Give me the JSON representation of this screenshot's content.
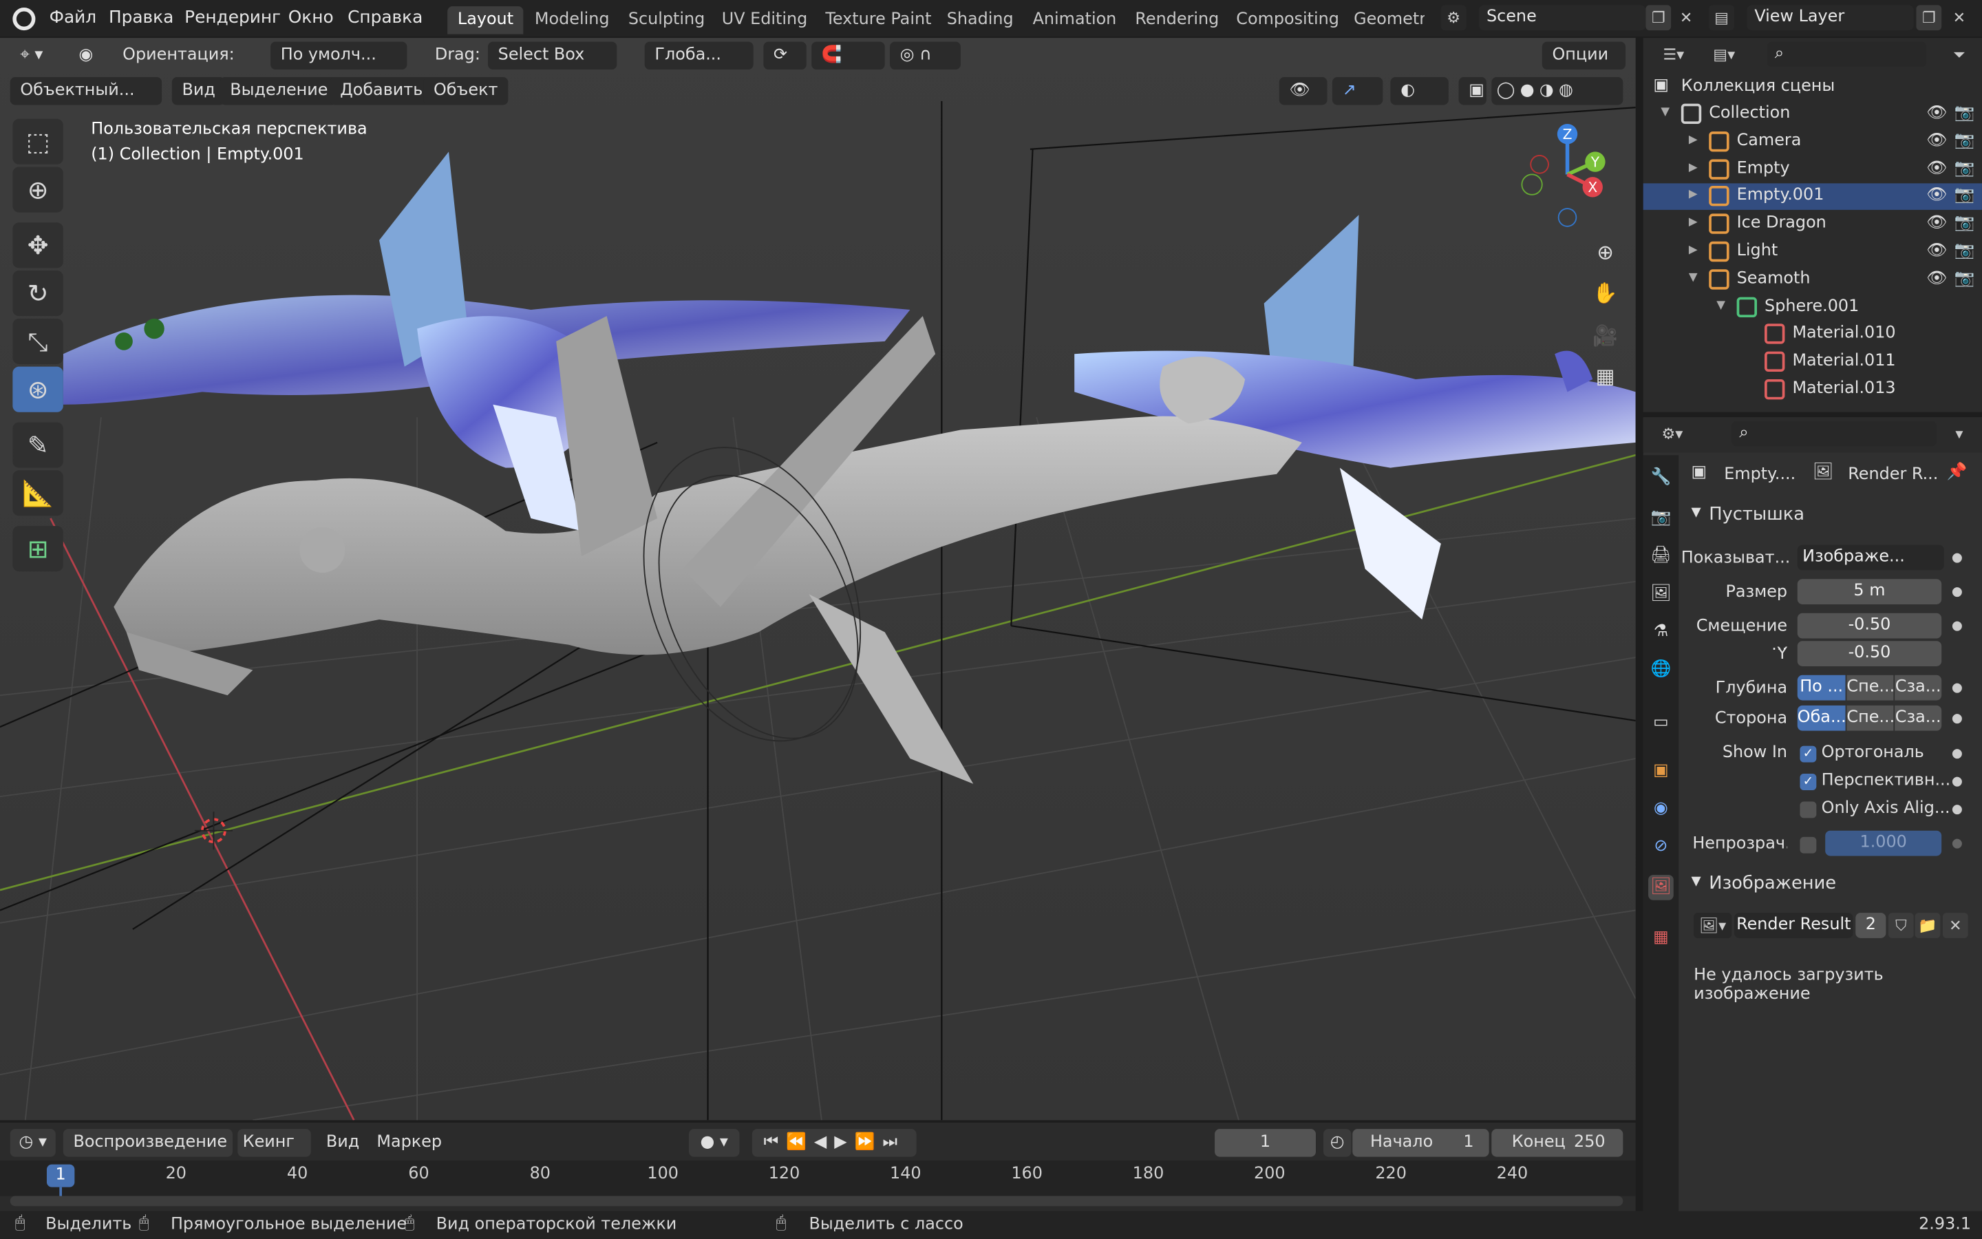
{
  "menu": [
    "Файл",
    "Правка",
    "Рендеринг",
    "Окно",
    "Справка"
  ],
  "workspaces": [
    "Layout",
    "Modeling",
    "Sculpting",
    "UV Editing",
    "Texture Paint",
    "Shading",
    "Animation",
    "Rendering",
    "Compositing",
    "Geometry"
  ],
  "active_workspace": "Layout",
  "scene": "Scene",
  "view_layer": "View Layer",
  "viewport_header": {
    "orientation_label": "Ориентация:",
    "orientation_value": "По умолч...",
    "drag_label": "Drag:",
    "drag_value": "Select Box",
    "transform": "Глоба...",
    "options": "Опции",
    "mode": "Объектный...",
    "view": "Вид",
    "select": "Выделение",
    "add": "Добавить",
    "object": "Объект"
  },
  "overlay_text": {
    "perspective": "Пользовательская перспектива",
    "collection_info": "(1) Collection | Empty.001"
  },
  "gizmo": {
    "z": "Z",
    "y": "Y",
    "x": "X"
  },
  "tools": [
    "select-box",
    "cursor",
    "move",
    "rotate",
    "scale",
    "transform",
    "annotate",
    "measure",
    "add-cube"
  ],
  "timeline": {
    "playback": "Воспроизведение",
    "keying": "Кеинг",
    "view": "Вид",
    "marker": "Маркер",
    "current_frame": "1",
    "start_label": "Начало",
    "start": "1",
    "end_label": "Конец",
    "end": "250",
    "ticks": [
      "1",
      "20",
      "40",
      "60",
      "80",
      "100",
      "120",
      "140",
      "160",
      "180",
      "200",
      "220",
      "240"
    ]
  },
  "outliner": {
    "root": "Коллекция сцены",
    "items": [
      {
        "name": "Collection",
        "level": 0,
        "icon": "collection-icon",
        "color": "#cfcfcf",
        "open": true
      },
      {
        "name": "Camera",
        "level": 1,
        "icon": "camera-icon",
        "color": "#e59a44"
      },
      {
        "name": "Empty",
        "level": 1,
        "icon": "empty-image-icon",
        "color": "#e59a44"
      },
      {
        "name": "Empty.001",
        "level": 1,
        "icon": "empty-image-icon",
        "color": "#e59a44",
        "selected": true
      },
      {
        "name": "Ice Dragon",
        "level": 1,
        "icon": "mesh-object-icon",
        "color": "#e59a44"
      },
      {
        "name": "Light",
        "level": 1,
        "icon": "light-icon",
        "color": "#e59a44"
      },
      {
        "name": "Seamoth",
        "level": 1,
        "icon": "mesh-object-icon",
        "color": "#e59a44",
        "open": true
      },
      {
        "name": "Sphere.001",
        "level": 2,
        "icon": "mesh-data-icon",
        "color": "#4fc27c",
        "open": true
      },
      {
        "name": "Material.010",
        "level": 3,
        "icon": "material-icon",
        "color": "#e06060"
      },
      {
        "name": "Material.011",
        "level": 3,
        "icon": "material-icon",
        "color": "#e06060"
      },
      {
        "name": "Material.013",
        "level": 3,
        "icon": "material-icon",
        "color": "#e06060"
      }
    ]
  },
  "properties": {
    "object_name": "Empty....",
    "data_name": "Render R...",
    "panel_empty": "Пустышка",
    "display_label": "Показыват...",
    "display_value": "Изображе...",
    "size_label": "Размер",
    "size_value": "5 m",
    "offset_label": "Смещение ...",
    "offset_x": "-0.50",
    "offset_y_label": "Y",
    "offset_y": "-0.50",
    "depth_label": "Глубина",
    "depth_options": [
      "По ...",
      "Спе...",
      "Сза..."
    ],
    "side_label": "Сторона",
    "side_options": [
      "Оба...",
      "Спе...",
      "Сза..."
    ],
    "show_in_label": "Show In",
    "show_in": [
      {
        "label": "Ортогональ",
        "checked": true
      },
      {
        "label": "Перспективн...",
        "checked": true
      },
      {
        "label": "Only Axis Alig...",
        "checked": false
      }
    ],
    "opacity_label": "Непрозрач...",
    "opacity_value": "1.000",
    "panel_image": "Изображение",
    "image_name": "Render Result",
    "image_users": "2",
    "image_error": "Не удалось загрузить изображение"
  },
  "statusbar": {
    "select": "Выделить",
    "box_select": "Прямоугольное выделение",
    "dolly": "Вид операторской тележки",
    "lasso": "Выделить с лассо",
    "version": "2.93.1"
  }
}
